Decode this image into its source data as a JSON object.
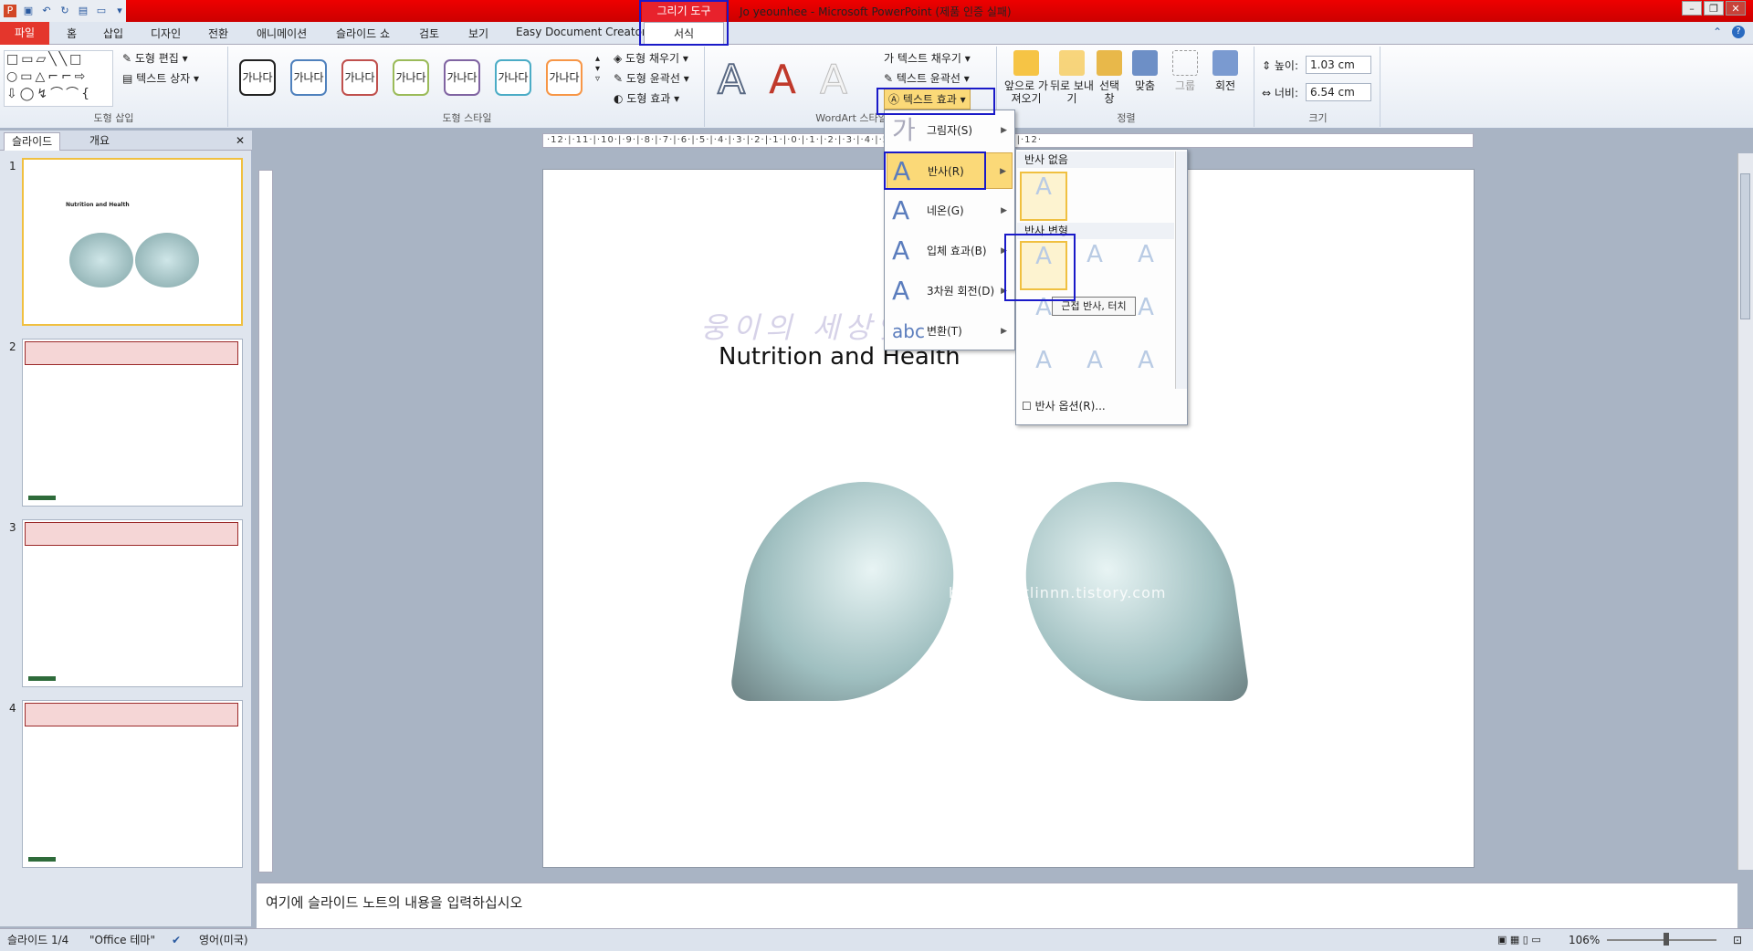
{
  "titlebar": {
    "title": "Jo yeounhee - Microsoft PowerPoint (제품 인증 실패)",
    "context_tab": "그리기 도구"
  },
  "tabs": [
    "홈",
    "삽입",
    "디자인",
    "전환",
    "애니메이션",
    "슬라이드 쇼",
    "검토",
    "보기",
    "Easy Document Creator"
  ],
  "file_tab": "파일",
  "active_tab": "서식",
  "ribbon": {
    "insert_shapes": {
      "label": "도형 삽입",
      "edit_shape": "도형 편집",
      "text_box": "텍스트 상자"
    },
    "shape_styles": {
      "label": "도형 스타일",
      "sample": "가나다",
      "fill": "도형 채우기",
      "outline": "도형 윤곽선",
      "effects": "도형 효과"
    },
    "wordart": {
      "label": "WordArt 스타일",
      "letter": "A",
      "text_fill": "텍스트 채우기",
      "text_outline": "텍스트 윤곽선",
      "text_effects": "텍스트 효과"
    },
    "arrange": {
      "label": "정렬",
      "bring_forward": "앞으로 가져오기",
      "send_backward": "뒤로 보내기",
      "selection_pane": "선택 창",
      "align": "맞춤",
      "group": "그룹",
      "rotate": "회전"
    },
    "size": {
      "label": "크기",
      "height_label": "높이:",
      "height_value": "1.03 cm",
      "width_label": "너비:",
      "width_value": "6.54 cm"
    }
  },
  "left_pane": {
    "tab_slides": "슬라이드",
    "tab_outline": "개요",
    "slide_numbers": [
      "1",
      "2",
      "3",
      "4"
    ],
    "thumb1_title": "Nutrition and Health"
  },
  "slide": {
    "title": "Nutrition and Health",
    "watermark": "웅이의 세상엿보기",
    "url_watermark": "https://jetlinnn.tistory.com"
  },
  "text_effects_menu": [
    {
      "label": "그림자(S)"
    },
    {
      "label": "반사(R)"
    },
    {
      "label": "네온(G)"
    },
    {
      "label": "입체 효과(B)"
    },
    {
      "label": "3차원 회전(D)"
    },
    {
      "label": "변환(T)"
    }
  ],
  "reflection_submenu": {
    "no_reflection": "반사 없음",
    "variations": "반사 변형",
    "tooltip": "근접 반사, 터치",
    "options": "반사 옵션(R)..."
  },
  "notes": {
    "placeholder": "여기에 슬라이드 노트의 내용을 입력하십시오"
  },
  "status": {
    "slide_pos": "슬라이드 1/4",
    "theme": "\"Office 테마\"",
    "language": "영어(미국)",
    "zoom": "106%"
  }
}
